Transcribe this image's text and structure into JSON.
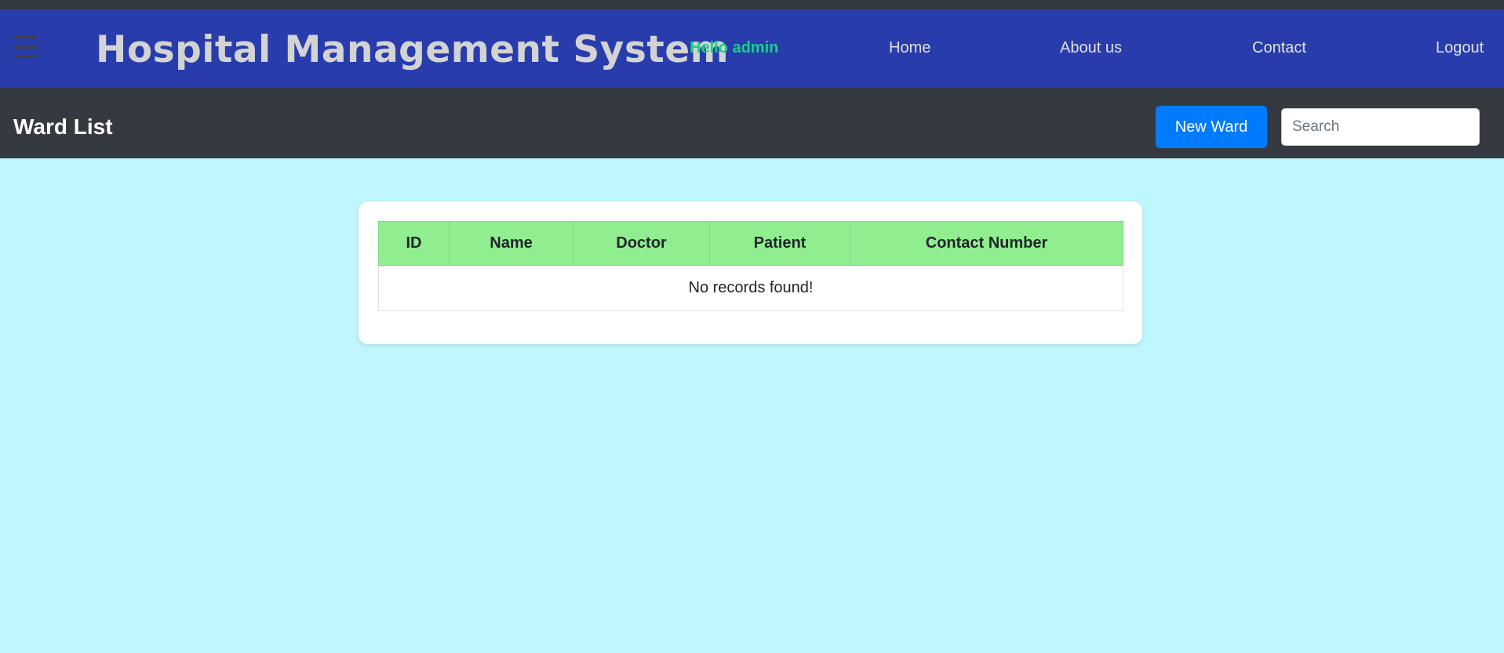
{
  "navbar": {
    "brand": "Hospital Management System",
    "greeting": "Hello admin",
    "links": {
      "home": "Home",
      "about": "About us",
      "contact": "Contact",
      "logout": "Logout"
    },
    "colors": {
      "background": "#283dab",
      "greeting": "#14d482"
    },
    "menu_icon": "hamburger-menu-icon"
  },
  "subbar": {
    "title": "Ward List",
    "new_button": "New Ward",
    "search_placeholder": "Search",
    "search_value": ""
  },
  "table": {
    "columns": [
      "ID",
      "Name",
      "Doctor",
      "Patient",
      "Contact Number"
    ],
    "empty_message": "No records found!",
    "header_color": "#90ee90"
  },
  "page": {
    "background": "#c0f6fd"
  }
}
